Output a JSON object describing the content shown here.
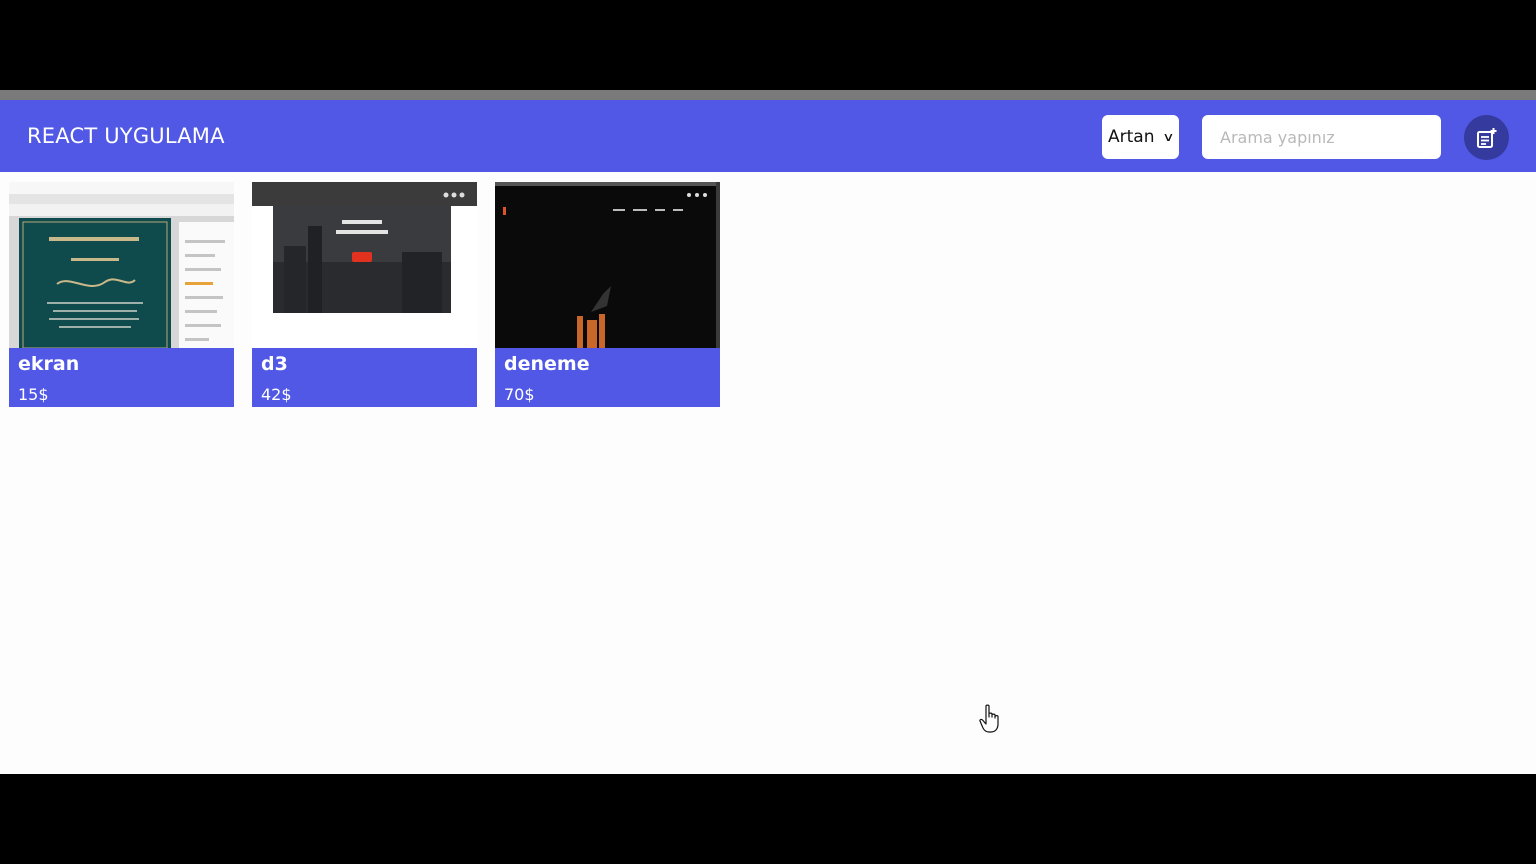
{
  "app": {
    "title": "REACT UYGULAMA",
    "accent_color": "#5058e5",
    "sort": {
      "selected": "Artan"
    },
    "search": {
      "placeholder": "Arama yapınız"
    },
    "add_icon": "add-note-icon"
  },
  "cards": [
    {
      "title": "ekran",
      "price": "15$"
    },
    {
      "title": "d3",
      "price": "42$"
    },
    {
      "title": "deneme",
      "price": "70$"
    }
  ]
}
